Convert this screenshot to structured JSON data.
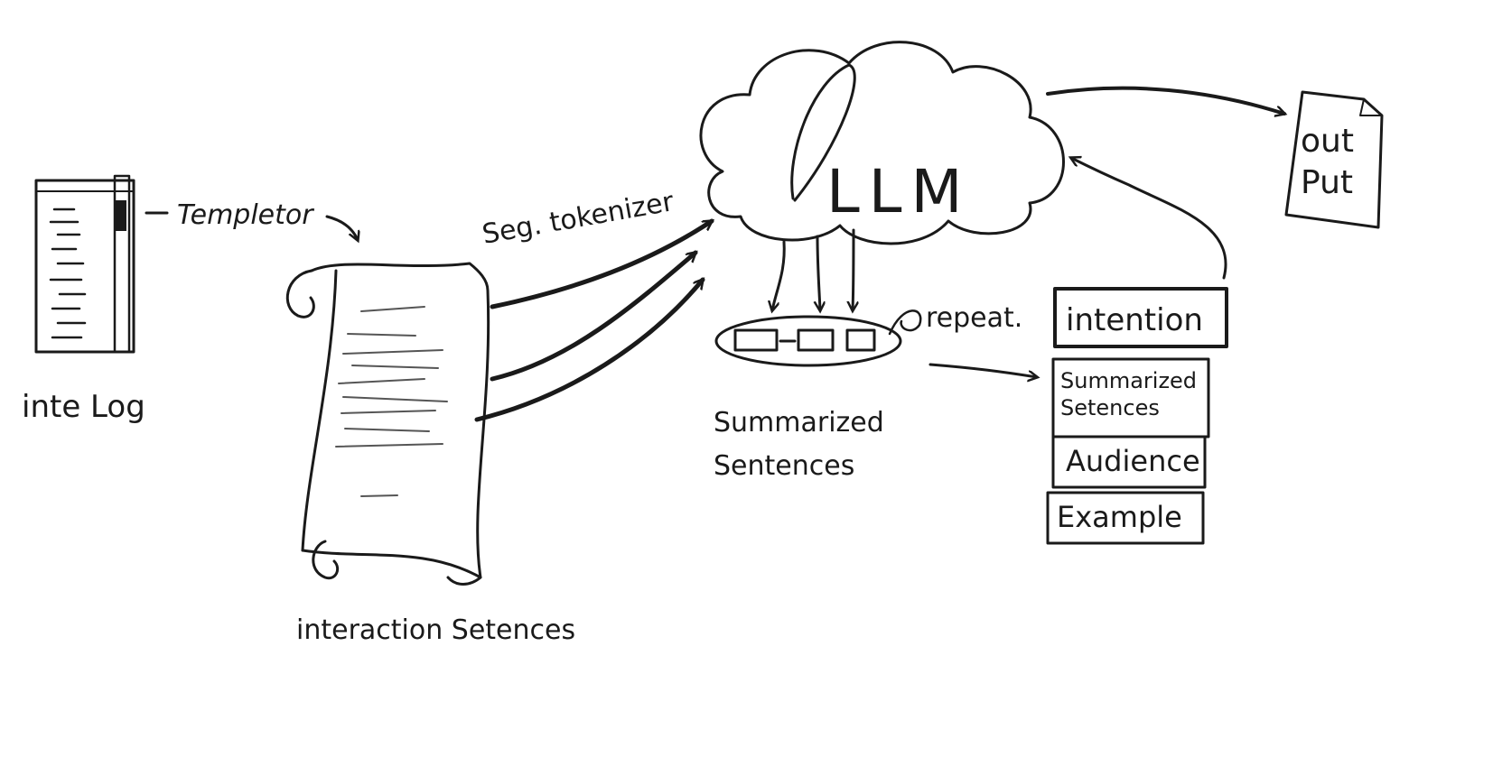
{
  "nodes": {
    "log": {
      "label": "inte Log"
    },
    "scroll": {
      "label": "interaction Setences"
    },
    "llm": {
      "label": "LLM"
    },
    "summary": {
      "label": "Summarized Sentences"
    },
    "stack": {
      "items": [
        "intention",
        "Summarized Setences",
        "Audience",
        "Example"
      ]
    },
    "output": {
      "label": "out Put"
    }
  },
  "edges": {
    "templator": "Templetor",
    "tokenizer": "Seg. tokenizer",
    "repeat": "repeat."
  }
}
